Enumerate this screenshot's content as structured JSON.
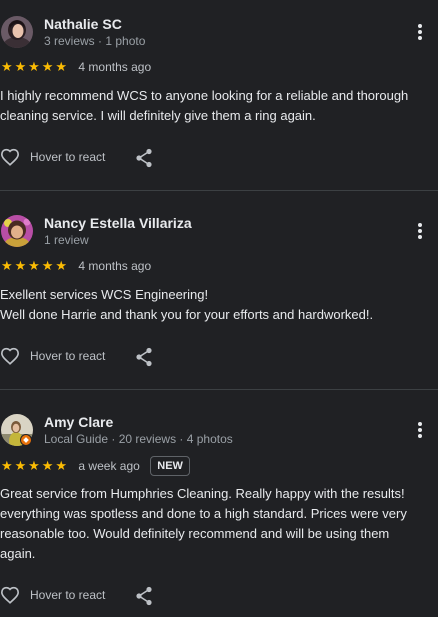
{
  "reviews": [
    {
      "name": "Nathalie SC",
      "meta": "3 reviews · 1 photo",
      "stars": [
        "★",
        "★",
        "★",
        "★",
        "★"
      ],
      "rating": 5,
      "when": "4 months ago",
      "text_lines": [
        "I highly recommend WCS to anyone looking for a reliable and thorough cleaning service. I will definitely give them a ring again."
      ],
      "react_label": "Hover to react"
    },
    {
      "name": "Nancy Estella Villariza",
      "meta": "1 review",
      "stars": [
        "★",
        "★",
        "★",
        "★",
        "★"
      ],
      "rating": 5,
      "when": "4 months ago",
      "text_lines": [
        "Exellent services WCS Engineering!",
        "Well done Harrie and thank you for your efforts and hardworked!."
      ],
      "react_label": "Hover to react"
    },
    {
      "name": "Amy Clare",
      "meta": "Local Guide · 20 reviews · 4 photos",
      "stars": [
        "★",
        "★",
        "★",
        "★",
        "★"
      ],
      "rating": 5,
      "when": "a week ago",
      "badge": "NEW",
      "text_lines": [
        "Great service from Humphries Cleaning. Really happy with the results! everything was spotless and done to a high standard. Prices were very reasonable too. Would definitely recommend and will be using them again."
      ],
      "react_label": "Hover to react"
    }
  ],
  "colors": {
    "background": "#202124",
    "star": "#fbbc04",
    "text": "#e8eaed",
    "muted": "#9aa0a6",
    "divider": "#3c4043",
    "local_guide_badge": "#e8710a"
  },
  "icons": {
    "more": "more-vert-icon",
    "react": "heart-outline-icon",
    "share": "share-icon",
    "local_guide": "local-guide-badge-icon"
  }
}
